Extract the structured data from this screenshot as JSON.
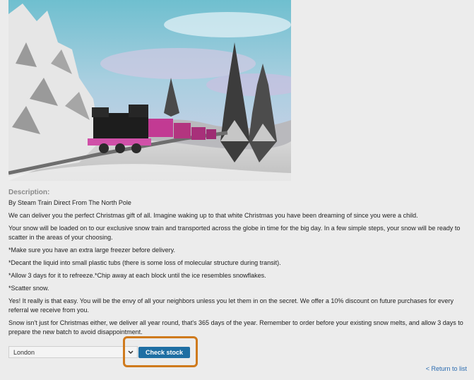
{
  "description": {
    "label": "Description:",
    "paragraphs": [
      "By Steam Train Direct From The North Pole",
      "We can deliver you the perfect Christmas gift of all. Imagine waking up to that white Christmas you have been dreaming of since you were a child.",
      "Your snow will be loaded on to our exclusive snow train and transported across the globe in time for the big day. In a few simple steps, your snow will be ready to scatter in the areas of your choosing.",
      "*Make sure you have an extra large freezer before delivery.",
      "*Decant the liquid into small plastic tubs (there is some loss of molecular structure during transit).",
      "*Allow 3 days for it to refreeze.*Chip away at each block until the ice resembles snowflakes.",
      "*Scatter snow.",
      "Yes! It really is that easy. You will be the envy of all your neighbors unless you let them in on the secret. We offer a 10% discount on future purchases for every referral we receive from you.",
      "Snow isn't just for Christmas either, we deliver all year round, that's 365 days of the year. Remember to order before your existing snow melts, and allow 3 days to prepare the new batch to avoid disappointment."
    ]
  },
  "stock": {
    "selected_location": "London",
    "check_label": "Check stock"
  },
  "nav": {
    "return_label": "< Return to list"
  },
  "colors": {
    "button": "#1f6fa3",
    "highlight": "#cf7a1d",
    "link": "#2b6cb0"
  },
  "icons": {
    "dropdown": "chevron-down-icon"
  }
}
